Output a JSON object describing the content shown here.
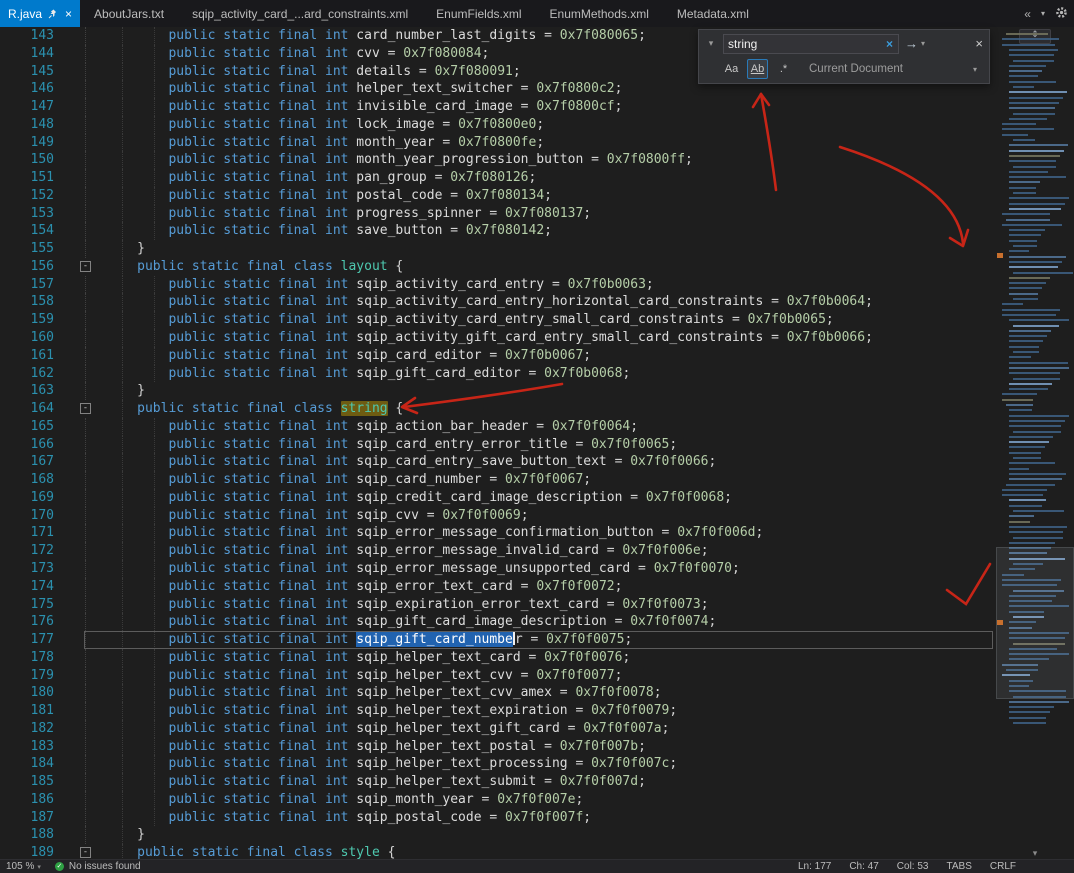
{
  "window": {
    "tabs": [
      {
        "label": "R.java",
        "active": true,
        "pinned": true
      },
      {
        "label": "AboutJars.txt"
      },
      {
        "label": "sqip_activity_card_...ard_constraints.xml"
      },
      {
        "label": "EnumFields.xml"
      },
      {
        "label": "EnumMethods.xml"
      },
      {
        "label": "Metadata.xml"
      }
    ]
  },
  "icons": {
    "overflow_chevrons": "«",
    "tab_list_caret": "▾",
    "caret_down": "▾",
    "split_grip": "↕",
    "scroll_down": "▾"
  },
  "find": {
    "query": "string",
    "expand_glyph": "▾",
    "clear_glyph": "×",
    "next_glyph": "→",
    "close_glyph": "×",
    "match_case": "Aa",
    "whole_word": "Ab",
    "regex": ".*",
    "scope": "Current Document"
  },
  "code": {
    "syntax": {
      "field_prefix": "public static final int ",
      "class_prefix": "public static final class ",
      "assign": " = ",
      "semi": ";",
      "open_brace": " {",
      "close_brace": "}"
    },
    "lines": [
      {
        "n": 143,
        "t": "f",
        "name": "card_number_last_digits",
        "val": "0x7f080065"
      },
      {
        "n": 144,
        "t": "f",
        "name": "cvv",
        "val": "0x7f080084"
      },
      {
        "n": 145,
        "t": "f",
        "name": "details",
        "val": "0x7f080091"
      },
      {
        "n": 146,
        "t": "f",
        "name": "helper_text_switcher",
        "val": "0x7f0800c2"
      },
      {
        "n": 147,
        "t": "f",
        "name": "invisible_card_image",
        "val": "0x7f0800cf"
      },
      {
        "n": 148,
        "t": "f",
        "name": "lock_image",
        "val": "0x7f0800e0"
      },
      {
        "n": 149,
        "t": "f",
        "name": "month_year",
        "val": "0x7f0800fe"
      },
      {
        "n": 150,
        "t": "f",
        "name": "month_year_progression_button",
        "val": "0x7f0800ff"
      },
      {
        "n": 151,
        "t": "f",
        "name": "pan_group",
        "val": "0x7f080126"
      },
      {
        "n": 152,
        "t": "f",
        "name": "postal_code",
        "val": "0x7f080134"
      },
      {
        "n": 153,
        "t": "f",
        "name": "progress_spinner",
        "val": "0x7f080137"
      },
      {
        "n": 154,
        "t": "f",
        "name": "save_button",
        "val": "0x7f080142"
      },
      {
        "n": 155,
        "t": "x"
      },
      {
        "n": 156,
        "t": "c",
        "name": "layout",
        "fold": true
      },
      {
        "n": 157,
        "t": "f",
        "name": "sqip_activity_card_entry",
        "val": "0x7f0b0063"
      },
      {
        "n": 158,
        "t": "f",
        "name": "sqip_activity_card_entry_horizontal_card_constraints",
        "val": "0x7f0b0064"
      },
      {
        "n": 159,
        "t": "f",
        "name": "sqip_activity_card_entry_small_card_constraints",
        "val": "0x7f0b0065"
      },
      {
        "n": 160,
        "t": "f",
        "name": "sqip_activity_gift_card_entry_small_card_constraints",
        "val": "0x7f0b0066"
      },
      {
        "n": 161,
        "t": "f",
        "name": "sqip_card_editor",
        "val": "0x7f0b0067"
      },
      {
        "n": 162,
        "t": "f",
        "name": "sqip_gift_card_editor",
        "val": "0x7f0b0068"
      },
      {
        "n": 163,
        "t": "x"
      },
      {
        "n": 164,
        "t": "c",
        "name": "string",
        "fold": true,
        "hl": true
      },
      {
        "n": 165,
        "t": "f",
        "name": "sqip_action_bar_header",
        "val": "0x7f0f0064"
      },
      {
        "n": 166,
        "t": "f",
        "name": "sqip_card_entry_error_title",
        "val": "0x7f0f0065"
      },
      {
        "n": 167,
        "t": "f",
        "name": "sqip_card_entry_save_button_text",
        "val": "0x7f0f0066"
      },
      {
        "n": 168,
        "t": "f",
        "name": "sqip_card_number",
        "val": "0x7f0f0067"
      },
      {
        "n": 169,
        "t": "f",
        "name": "sqip_credit_card_image_description",
        "val": "0x7f0f0068"
      },
      {
        "n": 170,
        "t": "f",
        "name": "sqip_cvv",
        "val": "0x7f0f0069"
      },
      {
        "n": 171,
        "t": "f",
        "name": "sqip_error_message_confirmation_button",
        "val": "0x7f0f006d"
      },
      {
        "n": 172,
        "t": "f",
        "name": "sqip_error_message_invalid_card",
        "val": "0x7f0f006e"
      },
      {
        "n": 173,
        "t": "f",
        "name": "sqip_error_message_unsupported_card",
        "val": "0x7f0f0070"
      },
      {
        "n": 174,
        "t": "f",
        "name": "sqip_error_text_card",
        "val": "0x7f0f0072"
      },
      {
        "n": 175,
        "t": "f",
        "name": "sqip_expiration_error_text_card",
        "val": "0x7f0f0073"
      },
      {
        "n": 176,
        "t": "f",
        "name": "sqip_gift_card_image_description",
        "val": "0x7f0f0074"
      },
      {
        "n": 177,
        "t": "f",
        "name": "sqip_gift_card_number",
        "val": "0x7f0f0075",
        "sel": true,
        "cur": true
      },
      {
        "n": 178,
        "t": "f",
        "name": "sqip_helper_text_card",
        "val": "0x7f0f0076"
      },
      {
        "n": 179,
        "t": "f",
        "name": "sqip_helper_text_cvv",
        "val": "0x7f0f0077"
      },
      {
        "n": 180,
        "t": "f",
        "name": "sqip_helper_text_cvv_amex",
        "val": "0x7f0f0078"
      },
      {
        "n": 181,
        "t": "f",
        "name": "sqip_helper_text_expiration",
        "val": "0x7f0f0079"
      },
      {
        "n": 182,
        "t": "f",
        "name": "sqip_helper_text_gift_card",
        "val": "0x7f0f007a"
      },
      {
        "n": 183,
        "t": "f",
        "name": "sqip_helper_text_postal",
        "val": "0x7f0f007b"
      },
      {
        "n": 184,
        "t": "f",
        "name": "sqip_helper_text_processing",
        "val": "0x7f0f007c"
      },
      {
        "n": 185,
        "t": "f",
        "name": "sqip_helper_text_submit",
        "val": "0x7f0f007d"
      },
      {
        "n": 186,
        "t": "f",
        "name": "sqip_month_year",
        "val": "0x7f0f007e"
      },
      {
        "n": 187,
        "t": "f",
        "name": "sqip_postal_code",
        "val": "0x7f0f007f"
      },
      {
        "n": 188,
        "t": "x"
      },
      {
        "n": 189,
        "t": "c",
        "name": "style",
        "fold": true
      }
    ]
  },
  "status": {
    "zoom": "105 %",
    "health": "No issues found",
    "ln": "Ln: 177",
    "ch": "Ch: 47",
    "col": "Col: 53",
    "tabs": "TABS",
    "eol": "CRLF"
  },
  "colors": {
    "active_tab": "#007acc",
    "keyword": "#569cd6",
    "class_name": "#4ec9b0",
    "number": "#b5cea8",
    "line_number": "#2b91af",
    "selection": "#2163b0",
    "find_highlight": "#6e5c12",
    "annotation_red": "#d62617",
    "health_green": "#2ea043",
    "minimap_marker": "#c8702e"
  }
}
